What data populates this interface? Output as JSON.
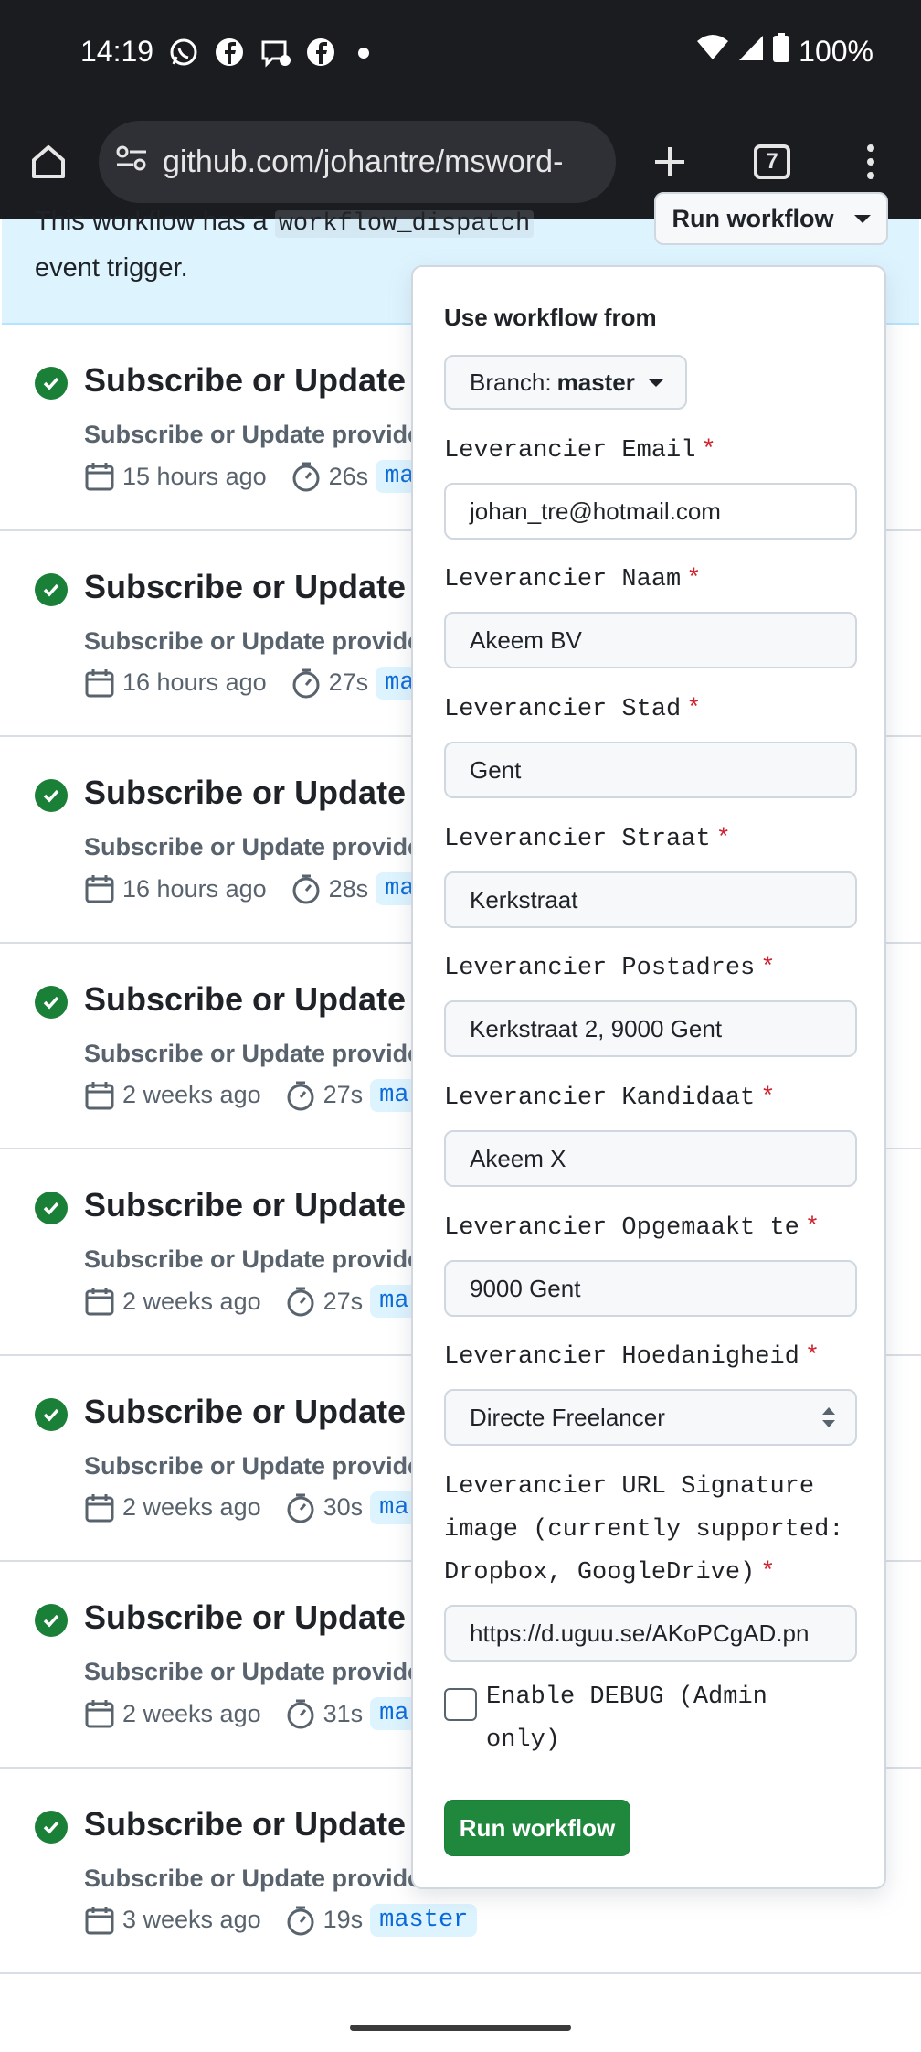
{
  "status": {
    "time": "14:19",
    "battery": "100%"
  },
  "browser": {
    "url": "github.com/johantre/msword-",
    "tab_count": "7"
  },
  "banner": {
    "text_before": "This workflow has a ",
    "code": "workflow_dispatch",
    "text_after": " event trigger.",
    "run_button": "Run workflow"
  },
  "runs": [
    {
      "title": "Subscribe or Update p",
      "subtitle": "Subscribe or Update provider",
      "when": "15 hours ago",
      "duration": "26s",
      "branch": "ma"
    },
    {
      "title": "Subscribe or Update p",
      "subtitle": "Subscribe or Update provider",
      "when": "16 hours ago",
      "duration": "27s",
      "branch": "ma"
    },
    {
      "title": "Subscribe or Update p",
      "subtitle": "Subscribe or Update provider",
      "when": "16 hours ago",
      "duration": "28s",
      "branch": "ma"
    },
    {
      "title": "Subscribe or Update p",
      "subtitle": "Subscribe or Update provider",
      "when": "2 weeks ago",
      "duration": "27s",
      "branch": "ma"
    },
    {
      "title": "Subscribe or Update p",
      "subtitle": "Subscribe or Update provider",
      "when": "2 weeks ago",
      "duration": "27s",
      "branch": "ma"
    },
    {
      "title": "Subscribe or Update p",
      "subtitle": "Subscribe or Update provider",
      "when": "2 weeks ago",
      "duration": "30s",
      "branch": "ma"
    },
    {
      "title": "Subscribe or Update p",
      "subtitle": "Subscribe or Update provider",
      "when": "2 weeks ago",
      "duration": "31s",
      "branch": "ma"
    },
    {
      "title": "Subscribe or Update p",
      "subtitle": "Subscribe or Update provider",
      "when": "3 weeks ago",
      "duration": "19s",
      "branch": "master"
    }
  ],
  "popover": {
    "heading": "Use workflow from",
    "branch_prefix": "Branch: ",
    "branch_name": "master",
    "required_mark": "*",
    "fields": [
      {
        "label": "Leverancier Email",
        "value": "johan_tre@hotmail.com"
      },
      {
        "label": "Leverancier Naam",
        "value": "Akeem BV"
      },
      {
        "label": "Leverancier Stad",
        "value": "Gent"
      },
      {
        "label": "Leverancier Straat",
        "value": "Kerkstraat"
      },
      {
        "label": "Leverancier Postadres",
        "value": "Kerkstraat 2, 9000 Gent"
      },
      {
        "label": "Leverancier Kandidaat",
        "value": "Akeem X"
      },
      {
        "label": "Leverancier Opgemaakt te",
        "value": "9000 Gent"
      },
      {
        "label": "Leverancier Hoedanigheid",
        "value": "Directe Freelancer"
      },
      {
        "label": "Leverancier URL Signature image (currently supported: Dropbox, GoogleDrive)",
        "value": "https://d.uguu.se/AKoPCgAD.pn"
      }
    ],
    "debug_label": "Enable DEBUG (Admin only)",
    "debug_checked": false,
    "submit_label": "Run workflow"
  }
}
